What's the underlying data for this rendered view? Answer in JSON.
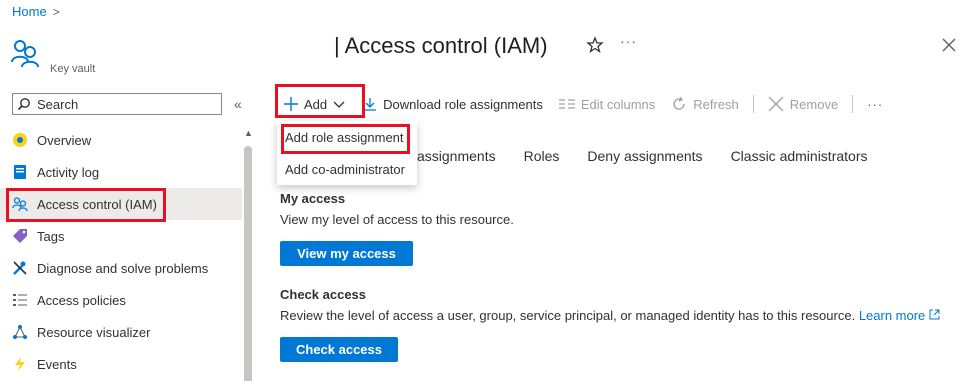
{
  "breadcrumb": {
    "home": "Home",
    "separator": ">"
  },
  "resource": {
    "type": "Key vault",
    "icon": "key-vault-users-icon"
  },
  "title": {
    "text": "| Access control (IAM)",
    "favorite_icon": "star-icon",
    "more": "···",
    "close_icon": "close-icon"
  },
  "sidebar": {
    "search_placeholder": "Search",
    "collapse": "«",
    "items": [
      {
        "label": "Overview",
        "icon": "overview-icon",
        "color": "#fcd116"
      },
      {
        "label": "Activity log",
        "icon": "activity-log-icon",
        "color": "#0078d4"
      },
      {
        "label": "Access control (IAM)",
        "icon": "iam-users-icon",
        "color": "#0078d4",
        "active": true
      },
      {
        "label": "Tags",
        "icon": "tag-icon",
        "color": "#8661c5"
      },
      {
        "label": "Diagnose and solve problems",
        "icon": "wrench-icon",
        "color": "#0078d4"
      },
      {
        "label": "Access policies",
        "icon": "list-icon",
        "color": "#605e5c"
      },
      {
        "label": "Resource visualizer",
        "icon": "network-icon",
        "color": "#0078d4"
      },
      {
        "label": "Events",
        "icon": "lightning-icon",
        "color": "#fcd116"
      }
    ]
  },
  "toolbar": {
    "add": "Add",
    "download": "Download role assignments",
    "edit_columns": "Edit columns",
    "refresh": "Refresh",
    "remove": "Remove",
    "more": "···"
  },
  "dropdown": {
    "items": [
      "Add role assignment",
      "Add co-administrator"
    ]
  },
  "tabs": [
    "assignments",
    "Roles",
    "Deny assignments",
    "Classic administrators"
  ],
  "my_access": {
    "title": "My access",
    "description": "View my level of access to this resource.",
    "button": "View my access"
  },
  "check_access": {
    "title": "Check access",
    "description": "Review the level of access a user, group, service principal, or managed identity has to this resource.",
    "learn_more": "Learn more",
    "button": "Check access"
  },
  "colors": {
    "accent": "#0078d4",
    "highlight": "#e81123"
  }
}
